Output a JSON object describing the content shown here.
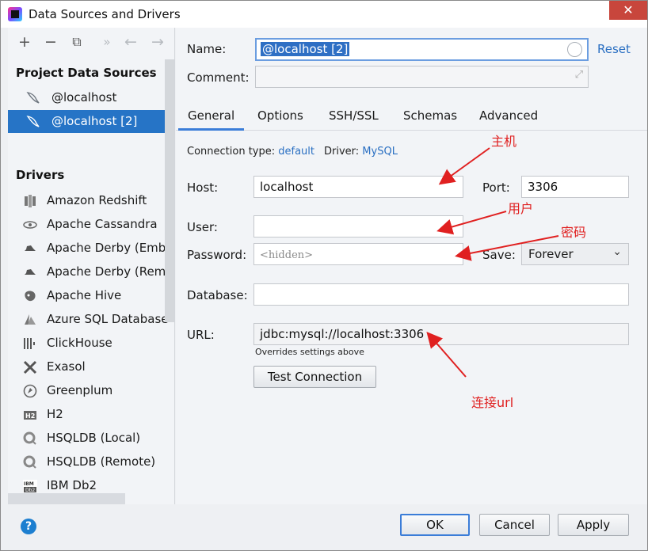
{
  "window": {
    "title": "Data Sources and Drivers",
    "close_glyph": "✕"
  },
  "toolbar": {
    "add": "+",
    "remove": "−",
    "duplicate": "⧉",
    "more": "»",
    "back": "←",
    "forward": "→"
  },
  "left": {
    "project_title": "Project Data Sources",
    "data_sources": [
      {
        "label": "@localhost",
        "icon": "mysql-dolphin-icon",
        "selected": false
      },
      {
        "label": "@localhost [2]",
        "icon": "mysql-dolphin-icon",
        "selected": true
      }
    ],
    "drivers_title": "Drivers",
    "drivers": [
      {
        "label": "Amazon Redshift",
        "icon": "redshift-icon"
      },
      {
        "label": "Apache Cassandra",
        "icon": "cassandra-eye-icon"
      },
      {
        "label": "Apache Derby (Embedded)",
        "icon": "derby-hat-icon"
      },
      {
        "label": "Apache Derby (Remote)",
        "icon": "derby-hat-icon"
      },
      {
        "label": "Apache Hive",
        "icon": "hive-icon"
      },
      {
        "label": "Azure SQL Database",
        "icon": "azure-icon"
      },
      {
        "label": "ClickHouse",
        "icon": "clickhouse-bars-icon"
      },
      {
        "label": "Exasol",
        "icon": "exasol-x-icon"
      },
      {
        "label": "Greenplum",
        "icon": "greenplum-icon"
      },
      {
        "label": "H2",
        "icon": "h2-icon"
      },
      {
        "label": "HSQLDB (Local)",
        "icon": "hsqldb-icon"
      },
      {
        "label": "HSQLDB (Remote)",
        "icon": "hsqldb-icon"
      },
      {
        "label": "IBM Db2",
        "icon": "ibm-db2-icon"
      }
    ]
  },
  "form": {
    "name_label": "Name:",
    "name_value": "@localhost [2]",
    "reset_label": "Reset",
    "comment_label": "Comment:",
    "comment_value": "",
    "tabs": [
      "General",
      "Options",
      "SSH/SSL",
      "Schemas",
      "Advanced"
    ],
    "active_tab": "General",
    "conn_type_label": "Connection type:",
    "conn_type_value": "default",
    "driver_label": "Driver:",
    "driver_value": "MySQL",
    "host_label": "Host:",
    "host_value": "localhost",
    "port_label": "Port:",
    "port_value": "3306",
    "user_label": "User:",
    "user_value": "",
    "password_label": "Password:",
    "password_placeholder": "<hidden>",
    "save_label": "Save:",
    "save_value": "Forever",
    "database_label": "Database:",
    "database_value": "",
    "url_label": "URL:",
    "url_value": "jdbc:mysql://localhost:3306",
    "url_hint": "Overrides settings above",
    "test_connection": "Test Connection"
  },
  "buttons": {
    "ok": "OK",
    "cancel": "Cancel",
    "apply": "Apply",
    "help": "?"
  },
  "annotations": {
    "host": "主机",
    "user": "用户",
    "password": "密码",
    "url": "连接url"
  },
  "colors": {
    "accent": "#2674c6",
    "link": "#2a6fc2",
    "annotation": "#e02020"
  }
}
